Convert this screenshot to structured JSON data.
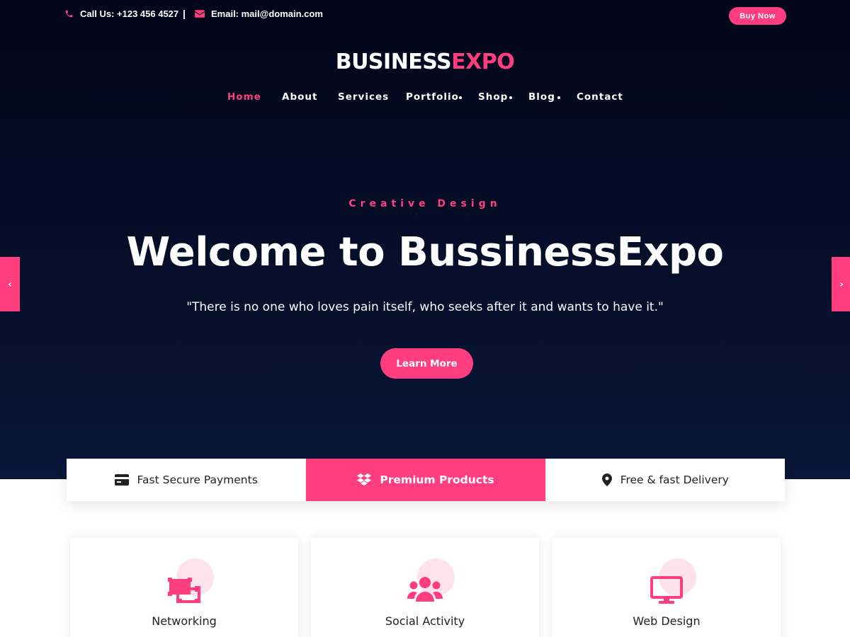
{
  "topbar": {
    "phone": "Call Us: +123 456 4527",
    "separator": "|",
    "email": "Email: mail@domain.com",
    "buy_now": "Buy Now"
  },
  "logo": {
    "part_a": "BUSINESS",
    "part_b": "EXPO"
  },
  "nav": {
    "items": [
      {
        "label": "Home",
        "active": true,
        "has_submenu": false
      },
      {
        "label": "About",
        "active": false,
        "has_submenu": false
      },
      {
        "label": "Services",
        "active": false,
        "has_submenu": false
      },
      {
        "label": "Portfolio",
        "active": false,
        "has_submenu": true
      },
      {
        "label": "Shop",
        "active": false,
        "has_submenu": true
      },
      {
        "label": "Blog",
        "active": false,
        "has_submenu": true
      },
      {
        "label": "Contact",
        "active": false,
        "has_submenu": false
      }
    ]
  },
  "hero": {
    "subtitle": "Creative Design",
    "title": "Welcome to BussinessExpo",
    "quote": "\"There is no one who loves pain itself, who seeks after it and wants to have it.\"",
    "cta": "Learn More",
    "prev_icon": "chevron-left-icon",
    "next_icon": "chevron-right-icon",
    "prev_glyph": "‹",
    "next_glyph": "›"
  },
  "features": [
    {
      "label": "Fast Secure Payments",
      "icon": "credit-card-icon",
      "active": false
    },
    {
      "label": "Premium Products",
      "icon": "dropbox-icon",
      "active": true
    },
    {
      "label": "Free & fast Delivery",
      "icon": "map-marker-icon",
      "active": false
    }
  ],
  "services": [
    {
      "title": "Networking",
      "icon": "network-icon"
    },
    {
      "title": "Social Activity",
      "icon": "users-icon"
    },
    {
      "title": "Web Design",
      "icon": "monitor-icon"
    }
  ],
  "colors": {
    "accent": "#ff3d7f",
    "hero_dark": "#02061a",
    "hero_light": "#0a1738",
    "blob": "#ffe3ec"
  }
}
